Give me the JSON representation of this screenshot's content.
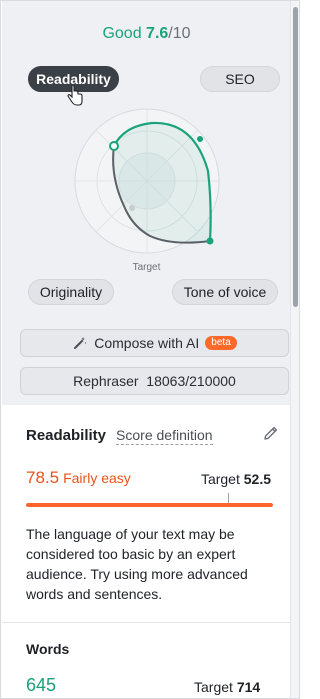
{
  "score": {
    "label": "Good",
    "value": "7.6",
    "max": "/10"
  },
  "tabs": {
    "readability": "Readability",
    "seo": "SEO",
    "originality": "Originality",
    "tone": "Tone of voice"
  },
  "radar": {
    "target_label": "Target"
  },
  "compose": {
    "label": "Compose with AI",
    "badge": "beta"
  },
  "rephraser": {
    "label": "Rephraser  18063/210000"
  },
  "readability": {
    "title": "Readability",
    "definition_link": "Score definition",
    "score": "78.5",
    "score_word": "Fairly easy",
    "target_label": "Target",
    "target_value": "52.5",
    "description": "The language of your text may be considered too basic by an expert audience. Try using more advanced words and sentences."
  },
  "words": {
    "title": "Words",
    "value": "645",
    "target_label": "Target",
    "target_value": "714"
  },
  "colors": {
    "good": "#1aa37a",
    "warning": "#e8541a",
    "active_chip": "#3b3f46"
  }
}
